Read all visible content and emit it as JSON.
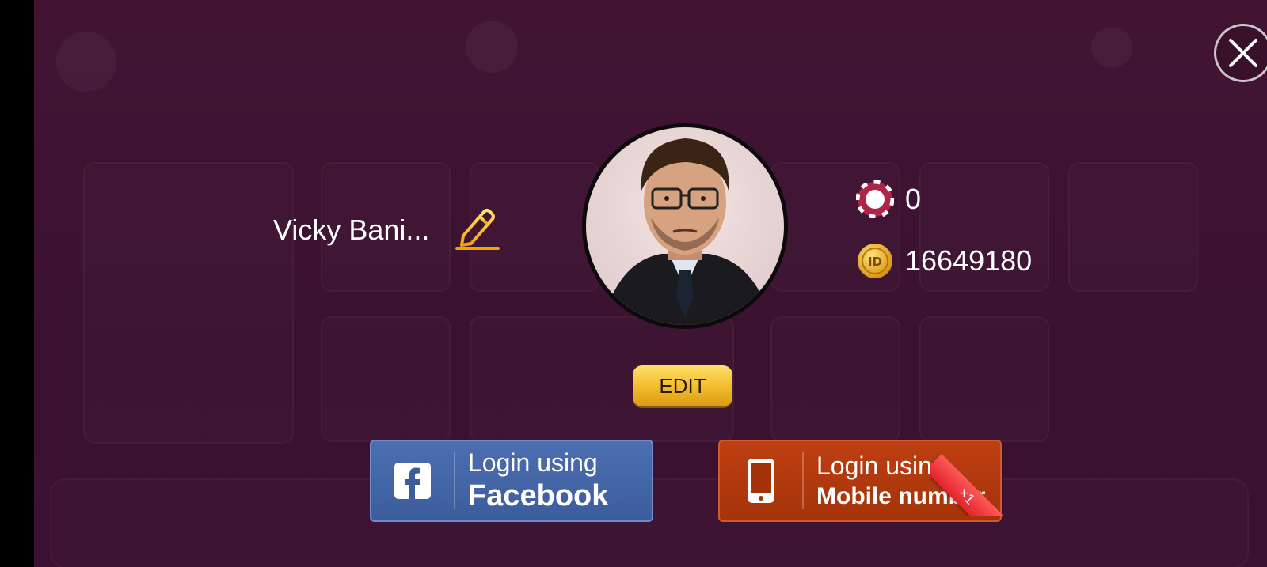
{
  "profile": {
    "name": "Vicky Bani...",
    "chips": "0",
    "id": "16649180",
    "edit_label": "EDIT"
  },
  "login": {
    "facebook": {
      "line1": "Login using",
      "line2": "Facebook"
    },
    "mobile": {
      "line1": "Login using",
      "line2": "Mobile number",
      "badge": "×1"
    }
  },
  "icons": {
    "close": "close-icon",
    "edit_name": "pencil-icon",
    "chips": "chip-icon",
    "id": "id-coin-icon",
    "facebook": "facebook-icon",
    "mobile": "smartphone-icon"
  },
  "colors": {
    "background": "#421432",
    "edit_button": "#f2bb2a",
    "facebook_button": "#3c5c9c",
    "mobile_button": "#a53309",
    "badge": "#e2222a"
  }
}
